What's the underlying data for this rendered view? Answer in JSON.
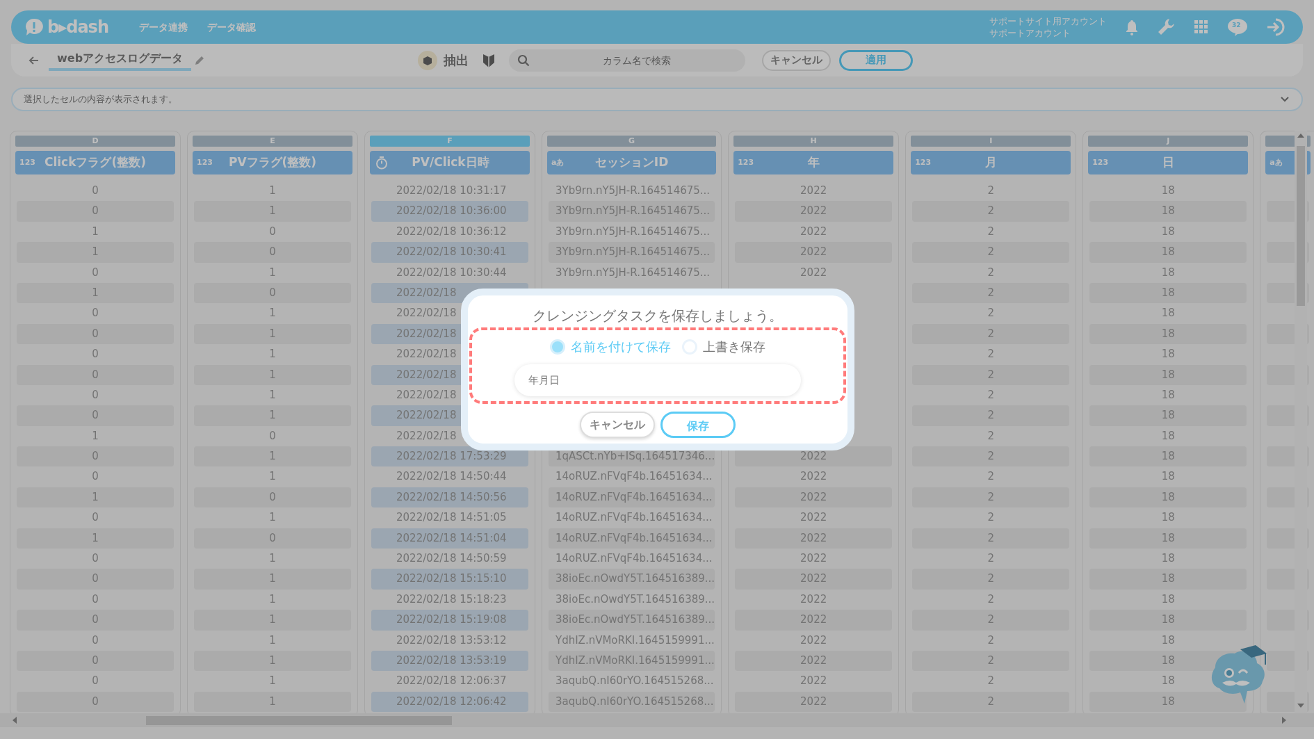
{
  "app_bar": {
    "logo": "b▸dash",
    "nav": [
      {
        "label": "データ連携"
      },
      {
        "label": "データ確認"
      }
    ],
    "account": [
      "サポートサイト用アカウント",
      "サポートアカウント"
    ],
    "chat_badge": "32"
  },
  "toolbar": {
    "title": "webアクセスログデータ",
    "extract_label": "抽出",
    "search": {
      "placeholder": "カラム名で検索"
    },
    "buttons": [
      {
        "label": "キャンセル",
        "kind": "secondary"
      },
      {
        "label": "適用",
        "kind": "primary"
      }
    ]
  },
  "cell_preview": {
    "placeholder": "選択したセルの内容が表示されます。"
  },
  "table": {
    "columns": [
      {
        "letter": "D",
        "kind": "number",
        "type_label": "123",
        "label": "Clickフラグ(整数)",
        "selected": false
      },
      {
        "letter": "E",
        "kind": "number",
        "type_label": "123",
        "label": "PVフラグ(整数)",
        "selected": false
      },
      {
        "letter": "F",
        "kind": "datetime",
        "label": "PV/Click日時",
        "selected": true
      },
      {
        "letter": "G",
        "kind": "text",
        "type_label": "aあ",
        "label": "セッションID",
        "selected": false
      },
      {
        "letter": "H",
        "kind": "number",
        "type_label": "123",
        "label": "年",
        "selected": false
      },
      {
        "letter": "I",
        "kind": "number",
        "type_label": "123",
        "label": "月",
        "selected": false
      },
      {
        "letter": "J",
        "kind": "number",
        "type_label": "123",
        "label": "日",
        "selected": false
      },
      {
        "kind": "text",
        "type_label": "aあ",
        "selected": false
      }
    ],
    "rows": [
      [
        "0",
        "1",
        "2022/02/18 10:31:17",
        "3Yb9rn.nY5JH-R.164514675...",
        "2022",
        "2",
        "18"
      ],
      [
        "0",
        "1",
        "2022/02/18 10:36:00",
        "3Yb9rn.nY5JH-R.164514675...",
        "2022",
        "2",
        "18"
      ],
      [
        "1",
        "0",
        "2022/02/18 10:36:12",
        "3Yb9rn.nY5JH-R.164514675...",
        "2022",
        "2",
        "18"
      ],
      [
        "1",
        "0",
        "2022/02/18 10:30:41",
        "3Yb9rn.nY5JH-R.164514675...",
        "2022",
        "2",
        "18"
      ],
      [
        "0",
        "1",
        "2022/02/18 10:30:44",
        "3Yb9rn.nY5JH-R.164514675...",
        "2022",
        "2",
        "18"
      ],
      [
        "1",
        "0",
        "2022/02/18",
        null,
        null,
        "2",
        "18"
      ],
      [
        "0",
        "1",
        "2022/02/18",
        null,
        null,
        "2",
        "18"
      ],
      [
        "0",
        "1",
        "2022/02/18",
        null,
        null,
        "2",
        "18"
      ],
      [
        "0",
        "1",
        "2022/02/18",
        null,
        null,
        "2",
        "18"
      ],
      [
        "0",
        "1",
        "2022/02/18",
        null,
        null,
        "2",
        "18"
      ],
      [
        "0",
        "1",
        "2022/02/18",
        null,
        null,
        "2",
        "18"
      ],
      [
        "0",
        "1",
        "2022/02/18",
        null,
        null,
        "2",
        "18"
      ],
      [
        "1",
        "0",
        "2022/02/18",
        null,
        null,
        "2",
        "18"
      ],
      [
        "0",
        "1",
        "2022/02/18 17:53:29",
        "1qASCt.nYb+ISq.164517346...",
        "2022",
        "2",
        "18"
      ],
      [
        "0",
        "1",
        "2022/02/18 14:50:44",
        "14oRUZ.nFVqF4b.16451634...",
        "2022",
        "2",
        "18"
      ],
      [
        "1",
        "0",
        "2022/02/18 14:50:56",
        "14oRUZ.nFVqF4b.16451634...",
        "2022",
        "2",
        "18"
      ],
      [
        "0",
        "1",
        "2022/02/18 14:51:05",
        "14oRUZ.nFVqF4b.16451634...",
        "2022",
        "2",
        "18"
      ],
      [
        "1",
        "0",
        "2022/02/18 14:51:04",
        "14oRUZ.nFVqF4b.16451634...",
        "2022",
        "2",
        "18"
      ],
      [
        "0",
        "1",
        "2022/02/18 14:50:59",
        "14oRUZ.nFVqF4b.16451634...",
        "2022",
        "2",
        "18"
      ],
      [
        "0",
        "1",
        "2022/02/18 15:15:10",
        "38ioEc.nOwdY5T.164516389...",
        "2022",
        "2",
        "18"
      ],
      [
        "0",
        "1",
        "2022/02/18 15:18:23",
        "38ioEc.nOwdY5T.164516389...",
        "2022",
        "2",
        "18"
      ],
      [
        "0",
        "1",
        "2022/02/18 15:19:08",
        "38ioEc.nOwdY5T.164516389...",
        "2022",
        "2",
        "18"
      ],
      [
        "0",
        "1",
        "2022/02/18 13:53:12",
        "YdhIZ.nVMoRKI.1645159991...",
        "2022",
        "2",
        "18"
      ],
      [
        "0",
        "1",
        "2022/02/18 13:53:19",
        "YdhIZ.nVMoRKI.1645159991...",
        "2022",
        "2",
        "18"
      ],
      [
        "0",
        "1",
        "2022/02/18 12:06:37",
        "3aqubQ.nI60rYO.164515268...",
        "2022",
        "2",
        "18"
      ],
      [
        "0",
        "1",
        "2022/02/18 12:06:42",
        "3aqubQ.nI60rYO.164515268...",
        "2022",
        "2",
        "18"
      ]
    ]
  },
  "modal": {
    "title": "クレンジングタスクを保存しましょう。",
    "highlighted": true,
    "options": [
      {
        "label": "名前を付けて保存",
        "selected": true
      },
      {
        "label": "上書き保存",
        "selected": false
      }
    ],
    "name_field": {
      "value": "年月日"
    },
    "buttons": [
      {
        "label": "キャンセル",
        "kind": "secondary"
      },
      {
        "label": "保存",
        "kind": "primary"
      }
    ]
  }
}
